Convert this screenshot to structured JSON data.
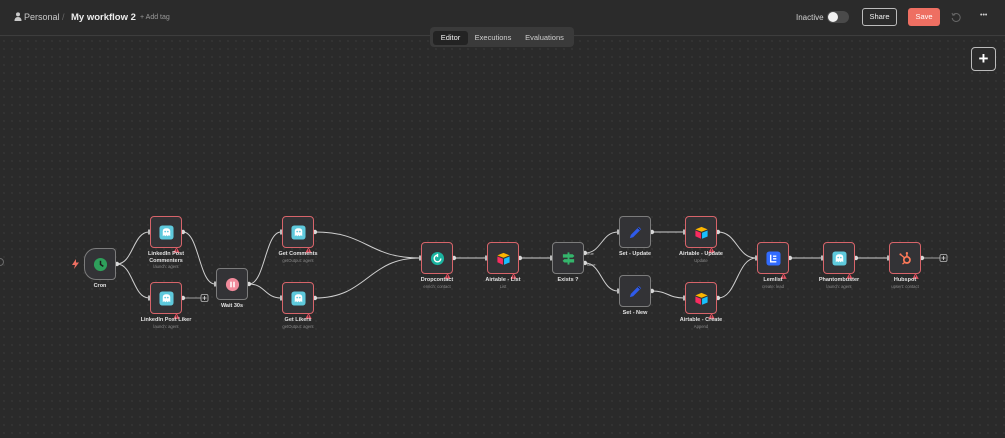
{
  "header": {
    "project": "Personal",
    "separator": "/",
    "workflow_name": "My workflow 2",
    "add_tag": "+ Add tag",
    "status_label": "Inactive",
    "share_label": "Share",
    "save_label": "Save",
    "more_label": "•••"
  },
  "tabs": [
    {
      "label": "Editor",
      "active": true
    },
    {
      "label": "Executions",
      "active": false
    },
    {
      "label": "Evaluations",
      "active": false
    }
  ],
  "canvas": {
    "add_node_label": "+",
    "branch_labels": {
      "true": "true",
      "false": "false"
    }
  },
  "nodes": [
    {
      "id": "cron",
      "label": "Cron",
      "sub": "",
      "icon": "clock-icon",
      "warning": false
    },
    {
      "id": "linkedin_commenters",
      "label": "LinkedIn Post Commenters",
      "sub": "launch: agent",
      "icon": "phantombuster-icon",
      "warning": true
    },
    {
      "id": "linkedin_liker",
      "label": "LinkedIn Post Liker",
      "sub": "launch: agent",
      "icon": "phantombuster-icon",
      "warning": true
    },
    {
      "id": "wait",
      "label": "Wait 30s",
      "sub": "",
      "icon": "pause-icon",
      "warning": false
    },
    {
      "id": "get_comments",
      "label": "Get Comments",
      "sub": "getOutput: agent",
      "icon": "phantombuster-icon",
      "warning": true
    },
    {
      "id": "get_likers",
      "label": "Get Likers",
      "sub": "getOutput: agent",
      "icon": "phantombuster-icon",
      "warning": true
    },
    {
      "id": "dropcontact",
      "label": "Dropcontact",
      "sub": "enrich: contact",
      "icon": "dropcontact-icon",
      "warning": true
    },
    {
      "id": "airtable_list",
      "label": "Airtable - List",
      "sub": "List",
      "icon": "airtable-icon",
      "warning": true
    },
    {
      "id": "exists",
      "label": "Exists ?",
      "sub": "",
      "icon": "if-signpost-icon",
      "warning": false
    },
    {
      "id": "set_update",
      "label": "Set - Update",
      "sub": "",
      "icon": "pen-icon",
      "warning": false
    },
    {
      "id": "set_new",
      "label": "Set - New",
      "sub": "",
      "icon": "pen-icon",
      "warning": false
    },
    {
      "id": "airtable_update",
      "label": "Airtable - Update",
      "sub": "Update",
      "icon": "airtable-icon",
      "warning": true
    },
    {
      "id": "airtable_create",
      "label": "Airtable - Create",
      "sub": "Append",
      "icon": "airtable-icon",
      "warning": true
    },
    {
      "id": "lemlist",
      "label": "Lemlist",
      "sub": "create: lead",
      "icon": "lemlist-icon",
      "warning": true
    },
    {
      "id": "phantombuster",
      "label": "Phantombuster",
      "sub": "launch: agent",
      "icon": "phantombuster-icon",
      "warning": true
    },
    {
      "id": "hubspot",
      "label": "Hubspot",
      "sub": "upsert: contact",
      "icon": "hubspot-icon",
      "warning": true
    }
  ],
  "colors": {
    "background": "#2a2a2a",
    "accent_save": "#ee6f62",
    "node_error_border": "#d7646a",
    "edge": "#cfcfcf"
  }
}
